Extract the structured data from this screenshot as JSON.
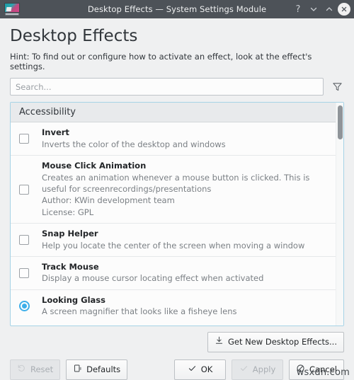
{
  "window": {
    "title": "Desktop Effects — System Settings Module",
    "app_icon": "desktop-effects-icon",
    "controls": {
      "help": "?",
      "shade_down": "chevron-down-icon",
      "shade_up": "chevron-up-icon",
      "close": "✕"
    }
  },
  "header": {
    "title": "Desktop Effects",
    "hint": "Hint: To find out or configure how to activate an effect, look at the effect's settings."
  },
  "search": {
    "placeholder": "Search...",
    "value": "",
    "filter_icon": "filter-funnel-icon"
  },
  "effects_list": {
    "category": "Accessibility",
    "items": [
      {
        "name": "Invert",
        "description": "Inverts the color of the desktop and windows",
        "control": "checkbox",
        "checked": false,
        "author": "",
        "license": ""
      },
      {
        "name": "Mouse Click Animation",
        "description": "Creates an animation whenever a mouse button is clicked. This is useful for screenrecordings/presentations",
        "control": "checkbox",
        "checked": false,
        "author": "Author: KWin development team",
        "license": "License: GPL"
      },
      {
        "name": "Snap Helper",
        "description": "Help you locate the center of the screen when moving a window",
        "control": "checkbox",
        "checked": false,
        "author": "",
        "license": ""
      },
      {
        "name": "Track Mouse",
        "description": "Display a mouse cursor locating effect when activated",
        "control": "checkbox",
        "checked": false,
        "author": "",
        "license": ""
      },
      {
        "name": "Looking Glass",
        "description": "A screen magnifier that looks like a fisheye lens",
        "control": "radio",
        "checked": true,
        "author": "",
        "license": ""
      }
    ]
  },
  "get_new": {
    "label": "Get New Desktop Effects...",
    "icon": "download-icon"
  },
  "footer": {
    "reset": {
      "label": "Reset",
      "icon": "undo-arrow-icon",
      "enabled": false
    },
    "defaults": {
      "label": "Defaults",
      "icon": "document-revert-icon",
      "enabled": true
    },
    "ok": {
      "label": "OK",
      "icon": "check-icon",
      "enabled": true
    },
    "apply": {
      "label": "Apply",
      "icon": "check-icon",
      "enabled": false
    },
    "cancel": {
      "label": "Cancel",
      "icon": "circle-slash-icon",
      "enabled": true
    }
  },
  "watermark": "wsxdn.com",
  "colors": {
    "titlebar": "#4d5258",
    "accent": "#3daee9",
    "background": "#eff0f1",
    "list_border": "#a6d3e6"
  }
}
